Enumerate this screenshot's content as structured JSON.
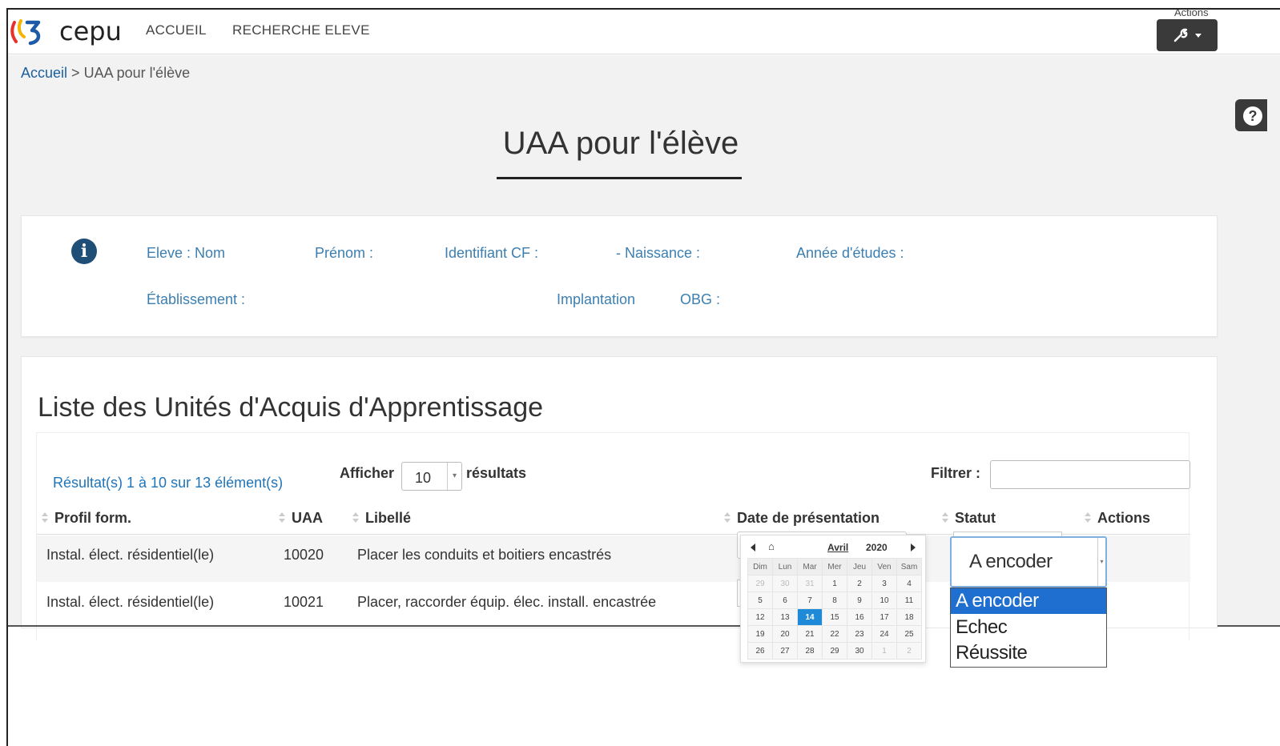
{
  "nav": {
    "brand": "cepu",
    "links": [
      "ACCUEIL",
      "RECHERCHE ELEVE"
    ],
    "actions_label": "Actions"
  },
  "breadcrumb": {
    "home": "Accueil",
    "separator": ">",
    "current": "UAA pour l'élève"
  },
  "page_title": "UAA pour l'élève",
  "student_info": {
    "eleve": "Eleve : Nom",
    "prenom": "Prénom :",
    "identifiant": "Identifiant CF :",
    "naissance": "- Naissance :",
    "annee": "Année d'études :",
    "etablissement": "Établissement :",
    "implantation": "Implantation",
    "obg": "OBG :"
  },
  "list": {
    "title": "Liste des Unités d'Acquis d'Apprentissage",
    "results_text": "Résultat(s) 1 à 10 sur 13 élément(s)",
    "afficher": "Afficher",
    "page_length": "10",
    "resultats": "résultats",
    "filtrer": "Filtrer :",
    "filter_value": "",
    "columns": [
      "Profil form.",
      "UAA",
      "Libellé",
      "Date de présentation",
      "Statut",
      "Actions"
    ],
    "rows": [
      {
        "profil": "Instal. élect. résidentiel(le)",
        "uaa": "10020",
        "libelle": "Placer les conduits et boitiers encastrés"
      },
      {
        "profil": "Instal. élect. résidentiel(le)",
        "uaa": "10021",
        "libelle": "Placer, raccorder équip. élec. install. encastrée"
      }
    ]
  },
  "datepicker": {
    "month": "Avril",
    "year": "2020",
    "days_of_week": [
      "Dim",
      "Lun",
      "Mar",
      "Mer",
      "Jeu",
      "Ven",
      "Sam"
    ],
    "weeks": [
      [
        "29",
        "30",
        "31",
        "1",
        "2",
        "3",
        "4"
      ],
      [
        "5",
        "6",
        "7",
        "8",
        "9",
        "10",
        "11"
      ],
      [
        "12",
        "13",
        "14",
        "15",
        "16",
        "17",
        "18"
      ],
      [
        "19",
        "20",
        "21",
        "22",
        "23",
        "24",
        "25"
      ],
      [
        "26",
        "27",
        "28",
        "29",
        "30",
        "1",
        "2"
      ]
    ],
    "selected_day": "14"
  },
  "status_select": {
    "value": "A encoder",
    "options": [
      "A encoder",
      "Echec",
      "Réussite"
    ]
  },
  "colors": {
    "link": "#1a5f9e",
    "info_label": "#3c7fb0",
    "selection": "#1f6fd0",
    "dark_button": "#3a3a3a"
  }
}
